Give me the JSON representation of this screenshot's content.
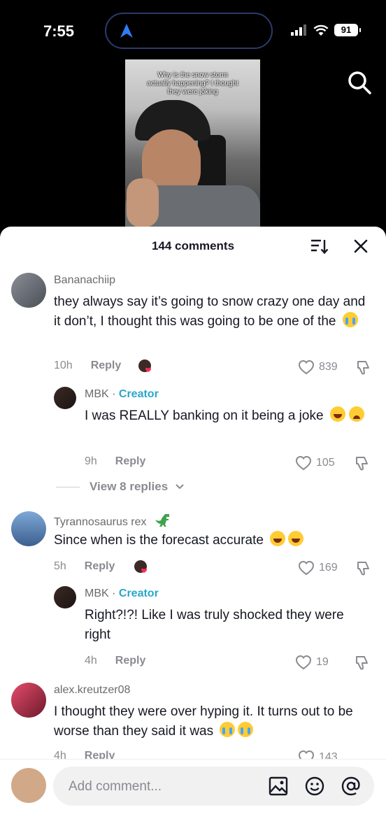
{
  "status_bar": {
    "time": "7:55",
    "battery": "91"
  },
  "video": {
    "caption": "Why is the snow storm actually happening? I thought they were joking"
  },
  "sheet": {
    "title": "144 comments"
  },
  "comments": [
    {
      "username": "Bananachiip",
      "text": "they always say it’s going to snow crazy one day and it don’t, I thought this was going to be one of the",
      "emoji": [
        "loudly-crying-face"
      ],
      "time": "10h",
      "reply_label": "Reply",
      "likes": "839",
      "reply": {
        "username": "MBK",
        "sep": " · ",
        "badge": "Creator",
        "text": "I was REALLY banking on it being a joke",
        "emoji": [
          "face-with-tears-of-joy",
          "weary-face"
        ],
        "time": "9h",
        "reply_label": "Reply",
        "likes": "105"
      },
      "view_replies": "View 8 replies"
    },
    {
      "username": "Tyrannosaurus rex",
      "username_emoji": "t-rex",
      "text": "Since when is the forecast accurate",
      "emoji": [
        "grinning-squinting-face",
        "grinning-squinting-face"
      ],
      "time": "5h",
      "reply_label": "Reply",
      "likes": "169",
      "reply": {
        "username": "MBK",
        "sep": " · ",
        "badge": "Creator",
        "text": "Right?!?! Like I was truly shocked they were right",
        "time": "4h",
        "reply_label": "Reply",
        "likes": "19"
      }
    },
    {
      "username": "alex.kreutzer08",
      "text": "I thought they were over hyping it. It turns out to be worse than they said it was",
      "emoji": [
        "loudly-crying-face",
        "loudly-crying-face"
      ],
      "time": "4h",
      "reply_label": "Reply",
      "likes": "143"
    }
  ],
  "composer": {
    "placeholder": "Add comment..."
  },
  "icons": {
    "navigation": "navigation-arrow-icon",
    "search": "search-icon",
    "sort": "sort-icon",
    "close": "close-icon",
    "like": "heart-outline-icon",
    "dislike": "thumbs-down-icon",
    "image": "image-icon",
    "emoji": "emoji-icon",
    "mention": "at-sign-icon"
  },
  "colors": {
    "creator_badge": "#2aa7c9",
    "island_border": "#2c3a6b",
    "nav_arrow": "#2f7cf6"
  }
}
